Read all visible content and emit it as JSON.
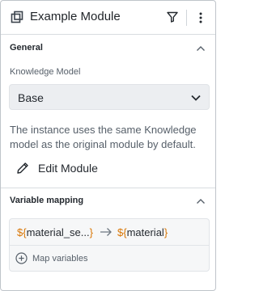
{
  "header": {
    "title": "Example Module",
    "icons": [
      "module-icon",
      "filter-icon",
      "more-vertical-icon"
    ]
  },
  "general": {
    "title": "General",
    "knowledge_model_label": "Knowledge Model",
    "knowledge_model_value": "Base",
    "help_text": "The instance uses the same Knowledge model as the original module by default.",
    "edit_label": "Edit Module"
  },
  "variable_mapping": {
    "title": "Variable mapping",
    "mapping": {
      "source_prefix": "${",
      "source_name": "material_se...",
      "source_suffix": "}",
      "target_prefix": "${",
      "target_name": "material",
      "target_suffix": "}"
    },
    "map_variables_label": "Map variables"
  },
  "colors": {
    "token": "#d97706",
    "accent_border": "#bfc4ca"
  }
}
